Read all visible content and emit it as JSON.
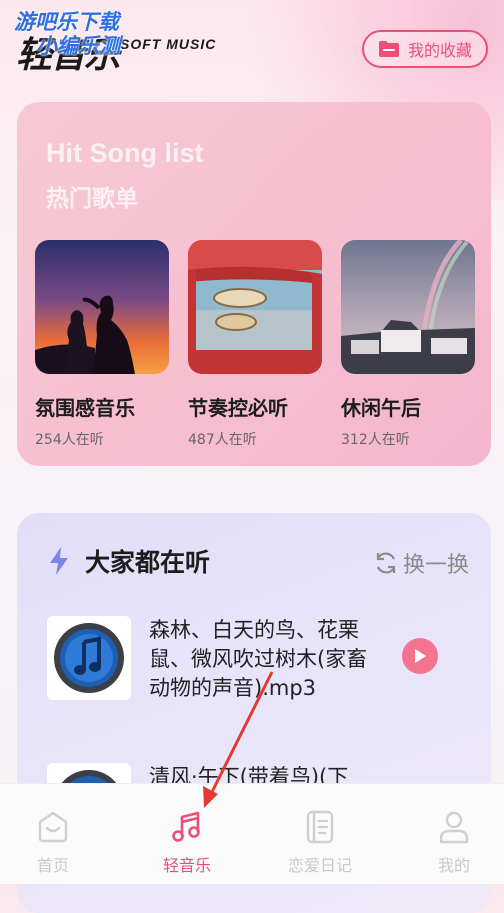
{
  "header": {
    "app_title": "轻音乐",
    "app_subtitle": "SOFT MUSIC",
    "watermark_line1": "游吧乐下载",
    "watermark_line2": "小编乐测",
    "favorites_button": "我的收藏",
    "favorites_icon": "folder-icon"
  },
  "hit_songs": {
    "title_en": "Hit Song list",
    "title_cn": "热门歌单",
    "items": [
      {
        "name": "氛围感音乐",
        "listeners": "254人在听"
      },
      {
        "name": "节奏控必听",
        "listeners": "487人在听"
      },
      {
        "name": "休闲午后",
        "listeners": "312人在听"
      }
    ]
  },
  "popular": {
    "title": "大家都在听",
    "refresh_label": "换一换",
    "tracks": [
      {
        "title": "森林、白天的鸟、花栗鼠、微风吹过树木(家畜动物的声音).mp3"
      },
      {
        "title": "清风·午下(带着鸟)(下"
      }
    ]
  },
  "tabbar": {
    "items": [
      {
        "label": "首页",
        "icon": "home-icon"
      },
      {
        "label": "轻音乐",
        "icon": "music-note-icon"
      },
      {
        "label": "恋爱日记",
        "icon": "diary-icon"
      },
      {
        "label": "我的",
        "icon": "profile-icon"
      }
    ],
    "active_index": 1
  },
  "colors": {
    "accent": "#ee4f77",
    "hit_card": "#f6c4d2",
    "listen_card": "#e5e1f9",
    "annotation_arrow": "#e53935"
  }
}
